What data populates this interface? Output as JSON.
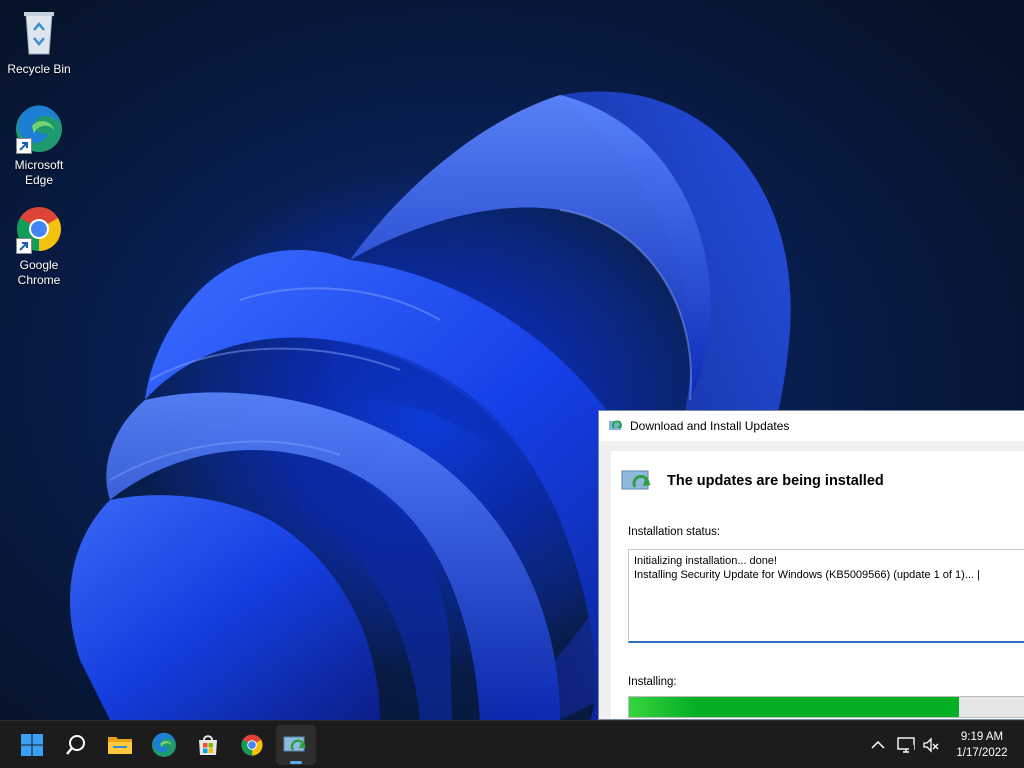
{
  "desktop": {
    "icons": [
      {
        "label": "Recycle Bin"
      },
      {
        "label": "Microsoft\nEdge"
      },
      {
        "label": "Google\nChrome"
      }
    ]
  },
  "dialog": {
    "title": "Download and Install Updates",
    "heading": "The updates are being installed",
    "status_label": "Installation status:",
    "status_lines": [
      "Initializing installation... done!",
      "Installing Security Update for Windows (KB5009566) (update 1 of 1)... |"
    ],
    "progress_label": "Installing:",
    "progress_fraction": 0.79
  },
  "taskbar": {
    "apps": [
      {
        "icon": "windows-start-icon",
        "active": false
      },
      {
        "icon": "search-icon",
        "active": false
      },
      {
        "icon": "file-explorer-icon",
        "active": false
      },
      {
        "icon": "edge-icon",
        "active": false
      },
      {
        "icon": "store-icon",
        "active": false
      },
      {
        "icon": "chrome-icon",
        "active": false
      },
      {
        "icon": "windows-update-icon",
        "active": true
      }
    ],
    "tray": {
      "time": "9:19 AM",
      "date": "1/17/2022"
    }
  },
  "colors": {
    "accent": "#0078d4",
    "progress_green": "#06b025",
    "taskbar_bg": "#1c1c1c"
  }
}
